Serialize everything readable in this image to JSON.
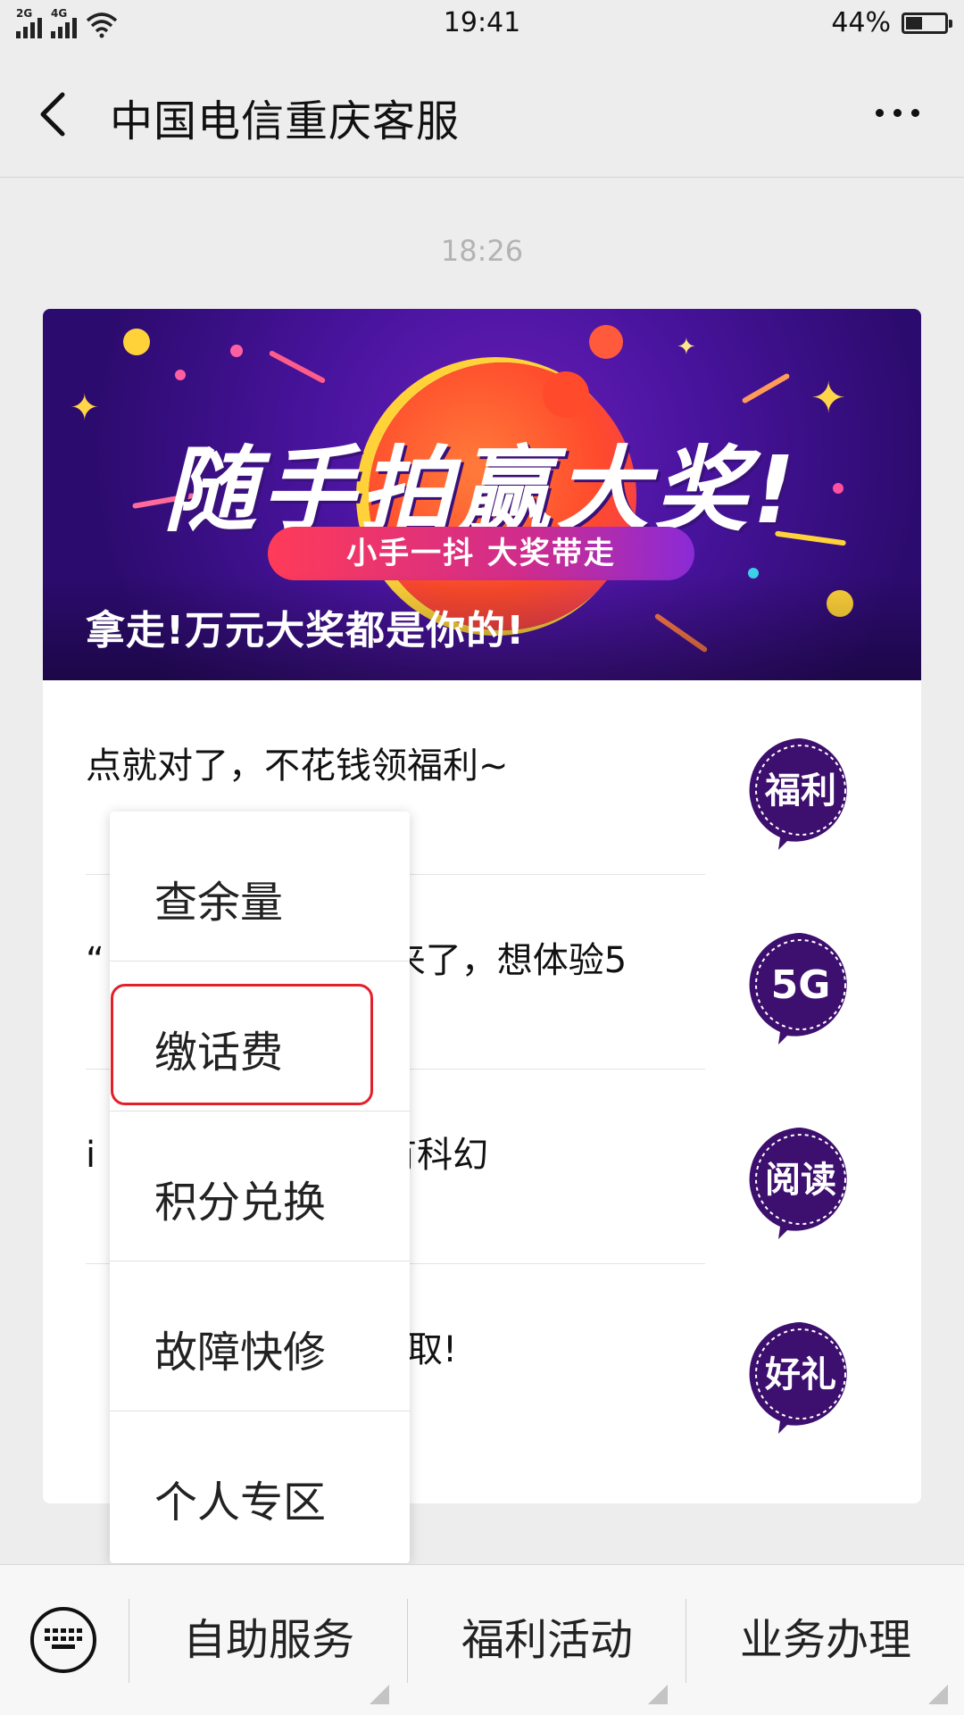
{
  "status_bar": {
    "network_1": "2G",
    "network_2": "4G",
    "time": "19:41",
    "battery": "44%",
    "battery_level": 0.44
  },
  "header": {
    "title": "中国电信重庆客服",
    "back_icon": "chevron-left-icon",
    "more_icon": "more-dots-icon"
  },
  "chat": {
    "timestamp": "18:26"
  },
  "card": {
    "banner": {
      "title": "随手拍赢大奖!",
      "pill": "小手一抖 大奖带走",
      "caption": "拿走!万元大奖都是你的!"
    },
    "articles": [
      {
        "text": "点就对了，不花钱领福利~",
        "badge": "福利"
      },
      {
        "text": "“　　　　　　　　来了，想体验5",
        "badge": "5G"
      },
      {
        "text": "i　　　　　　　也有科幻",
        "badge": "阅读"
      },
      {
        "text": "　　　　　　　元领取!",
        "badge": "好礼"
      }
    ]
  },
  "popup_menu": {
    "items": [
      "查余量",
      "缴话费",
      "积分兑换",
      "故障快修",
      "个人专区"
    ],
    "highlighted": "缴话费",
    "highlight_color": "#e3202a"
  },
  "bottom_bar": {
    "keyboard_icon": "keyboard-icon",
    "menus": [
      "自助服务",
      "福利活动",
      "业务办理"
    ]
  },
  "colors": {
    "banner_purple": "#4a14a0",
    "badge_purple": "#3d0f6e",
    "highlight_red": "#e3202a"
  }
}
